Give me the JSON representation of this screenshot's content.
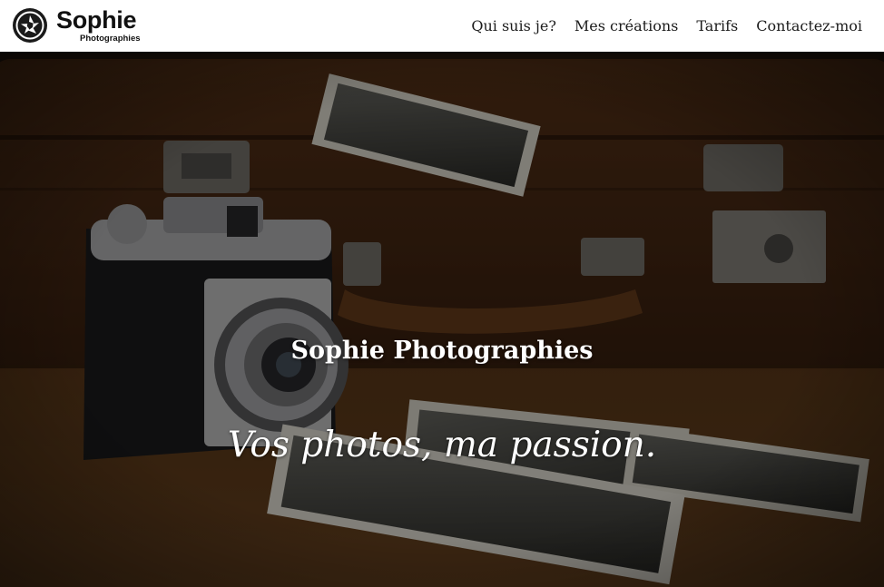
{
  "brand": {
    "name": "Sophie",
    "subtitle": "Photographies",
    "logo_icon": "camera-aperture-icon"
  },
  "nav": {
    "items": [
      {
        "label": "Qui suis je?"
      },
      {
        "label": "Mes créations"
      },
      {
        "label": "Tarifs"
      },
      {
        "label": "Contactez-moi"
      }
    ]
  },
  "hero": {
    "title": "Sophie Photographies",
    "tagline": "Vos photos, ma passion.",
    "background_description_icon": "vintage-camera-suitcase-photo",
    "overlay_color": "#000000"
  },
  "colors": {
    "header_bg": "#ffffff",
    "nav_text": "#1c1c1c",
    "hero_text": "#ffffff"
  }
}
